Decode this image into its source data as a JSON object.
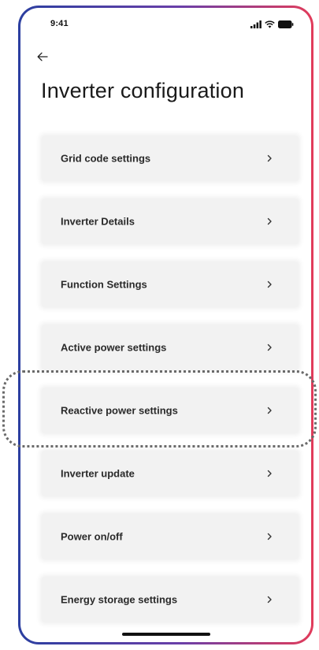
{
  "status_bar": {
    "time": "9:41",
    "icons": [
      "cellular-signal-icon",
      "wifi-icon",
      "battery-icon"
    ]
  },
  "header": {
    "back_icon": "arrow-left-icon",
    "title": "Inverter configuration"
  },
  "menu": {
    "items": [
      {
        "label": "Grid code settings"
      },
      {
        "label": "Inverter Details"
      },
      {
        "label": "Function Settings"
      },
      {
        "label": "Active power settings"
      },
      {
        "label": "Reactive power settings",
        "highlighted": true
      },
      {
        "label": "Inverter update"
      },
      {
        "label": "Power on/off"
      },
      {
        "label": "Energy storage settings"
      }
    ],
    "chevron_icon": "chevron-right-icon"
  },
  "colors": {
    "frame_gradient_start": "#2b3fa0",
    "frame_gradient_end": "#e23b5a",
    "item_background": "#f2f2f2",
    "highlight_border": "#6a6a6a"
  }
}
